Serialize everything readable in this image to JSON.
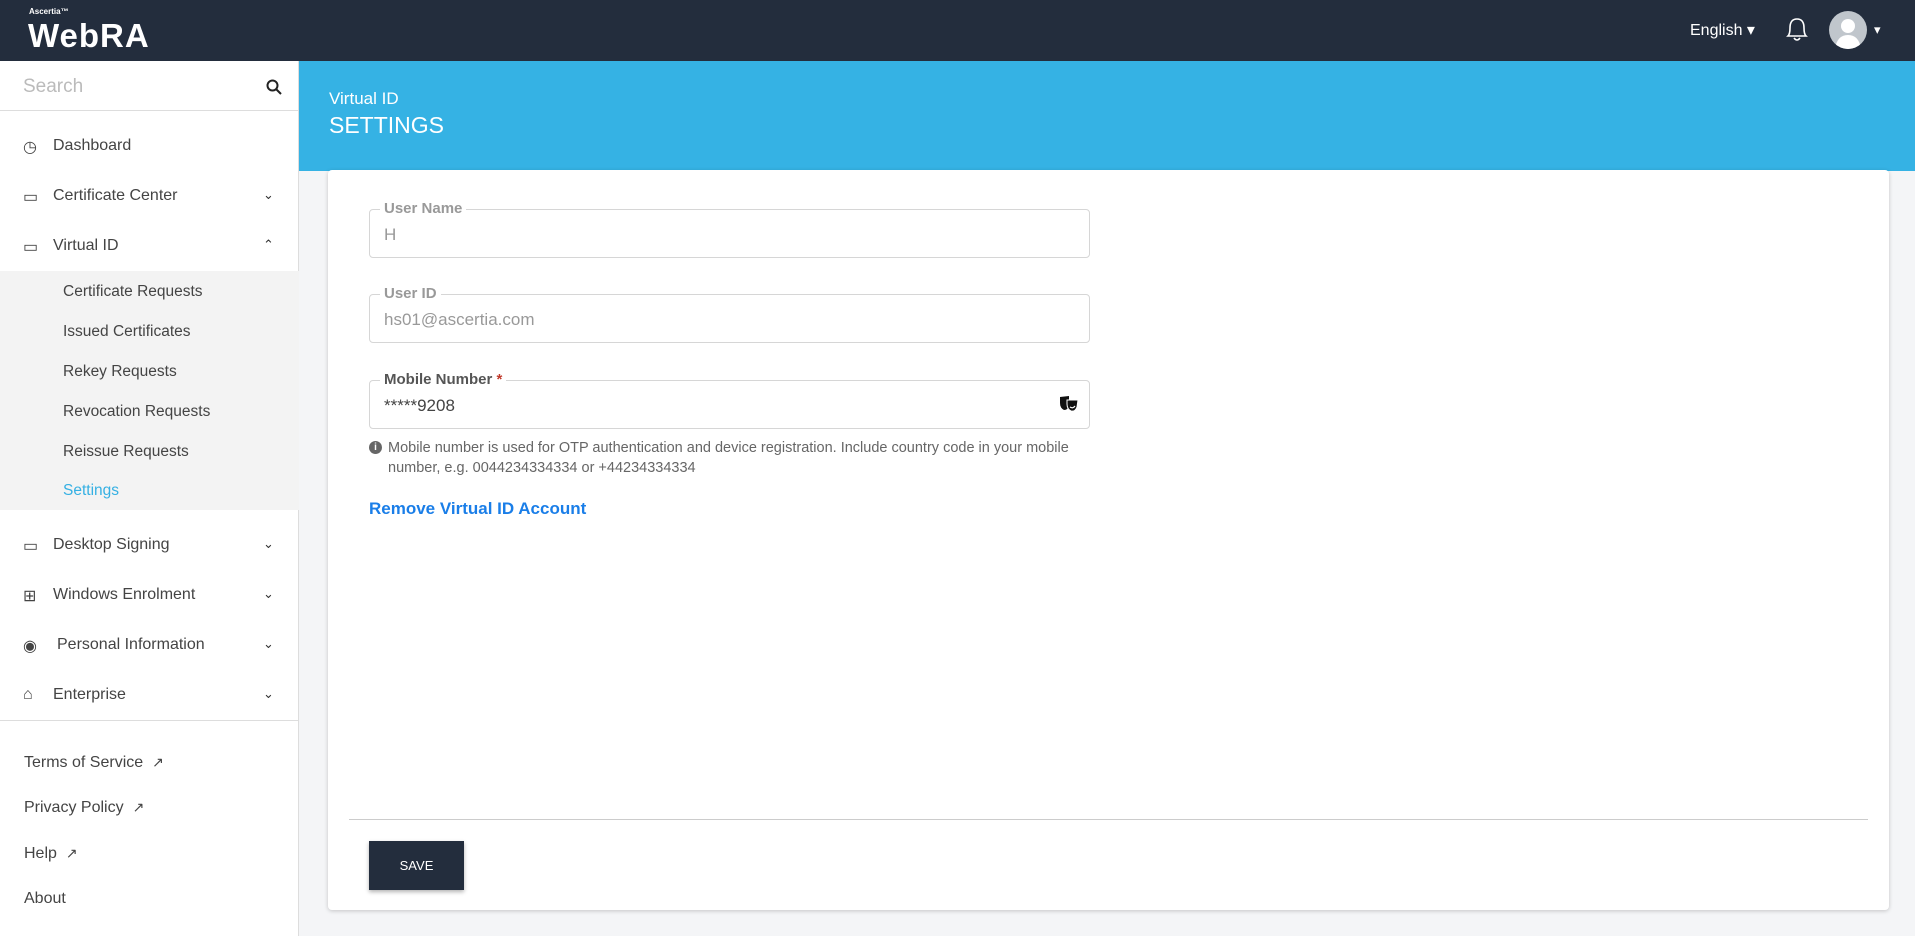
{
  "header": {
    "brand_small": "Ascertia™",
    "brand": "WebRA",
    "language": "English ▾",
    "avatar_caret": "▾"
  },
  "sidebar": {
    "search_placeholder": "Search",
    "items": [
      {
        "label": "Dashboard"
      },
      {
        "label": "Certificate Center"
      },
      {
        "label": "Virtual ID"
      },
      {
        "label": "Desktop Signing"
      },
      {
        "label": "Windows Enrolment"
      },
      {
        "label": "Personal Information"
      },
      {
        "label": "Enterprise"
      }
    ],
    "subitems": [
      {
        "label": "Certificate Requests"
      },
      {
        "label": "Issued Certificates"
      },
      {
        "label": "Rekey Requests"
      },
      {
        "label": "Revocation Requests"
      },
      {
        "label": "Reissue Requests"
      },
      {
        "label": "Settings"
      }
    ],
    "footer": [
      {
        "label": "Terms of Service"
      },
      {
        "label": "Privacy Policy"
      },
      {
        "label": "Help"
      },
      {
        "label": "About"
      }
    ]
  },
  "page": {
    "breadcrumb": "Virtual ID",
    "title": "SETTINGS"
  },
  "form": {
    "user_name_label": "User Name",
    "user_name_value": "H",
    "user_id_label": "User ID",
    "user_id_value": "hs01@ascertia.com",
    "mobile_label": "Mobile Number",
    "required_mark": "*",
    "mobile_value": "*****9208",
    "help_text": "Mobile number is used for OTP authentication and device registration. Include country code in your mobile number, e.g. 0044234334334 or +44234334334",
    "remove_link": "Remove Virtual ID Account",
    "save_label": "SAVE"
  }
}
